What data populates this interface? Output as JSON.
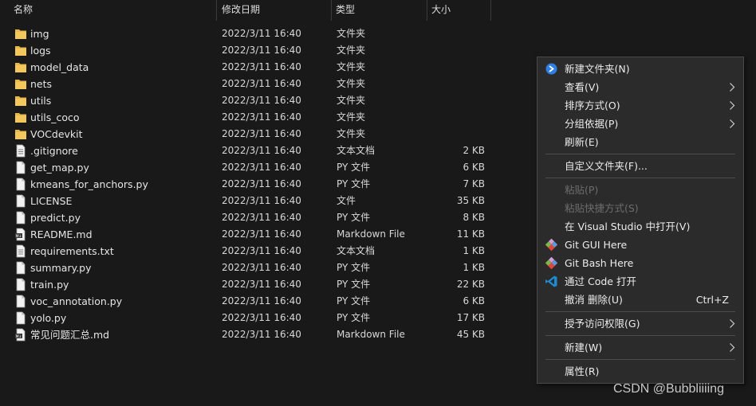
{
  "columns": {
    "name": "名称",
    "date": "修改日期",
    "type": "类型",
    "size": "大小"
  },
  "files": [
    {
      "name": "img",
      "date": "2022/3/11 16:40",
      "type": "文件夹",
      "size": "",
      "icon": "folder-icon"
    },
    {
      "name": "logs",
      "date": "2022/3/11 16:40",
      "type": "文件夹",
      "size": "",
      "icon": "folder-icon"
    },
    {
      "name": "model_data",
      "date": "2022/3/11 16:40",
      "type": "文件夹",
      "size": "",
      "icon": "folder-icon"
    },
    {
      "name": "nets",
      "date": "2022/3/11 16:40",
      "type": "文件夹",
      "size": "",
      "icon": "folder-icon"
    },
    {
      "name": "utils",
      "date": "2022/3/11 16:40",
      "type": "文件夹",
      "size": "",
      "icon": "folder-icon"
    },
    {
      "name": "utils_coco",
      "date": "2022/3/11 16:40",
      "type": "文件夹",
      "size": "",
      "icon": "folder-icon"
    },
    {
      "name": "VOCdevkit",
      "date": "2022/3/11 16:40",
      "type": "文件夹",
      "size": "",
      "icon": "folder-icon"
    },
    {
      "name": ".gitignore",
      "date": "2022/3/11 16:40",
      "type": "文本文档",
      "size": "2 KB",
      "icon": "text-file-icon"
    },
    {
      "name": "get_map.py",
      "date": "2022/3/11 16:40",
      "type": "PY 文件",
      "size": "6 KB",
      "icon": "file-icon"
    },
    {
      "name": "kmeans_for_anchors.py",
      "date": "2022/3/11 16:40",
      "type": "PY 文件",
      "size": "7 KB",
      "icon": "file-icon"
    },
    {
      "name": "LICENSE",
      "date": "2022/3/11 16:40",
      "type": "文件",
      "size": "35 KB",
      "icon": "file-icon"
    },
    {
      "name": "predict.py",
      "date": "2022/3/11 16:40",
      "type": "PY 文件",
      "size": "8 KB",
      "icon": "file-icon"
    },
    {
      "name": "README.md",
      "date": "2022/3/11 16:40",
      "type": "Markdown File",
      "size": "11 KB",
      "icon": "markdown-file-icon"
    },
    {
      "name": "requirements.txt",
      "date": "2022/3/11 16:40",
      "type": "文本文档",
      "size": "1 KB",
      "icon": "text-file-icon"
    },
    {
      "name": "summary.py",
      "date": "2022/3/11 16:40",
      "type": "PY 文件",
      "size": "1 KB",
      "icon": "file-icon"
    },
    {
      "name": "train.py",
      "date": "2022/3/11 16:40",
      "type": "PY 文件",
      "size": "22 KB",
      "icon": "file-icon"
    },
    {
      "name": "voc_annotation.py",
      "date": "2022/3/11 16:40",
      "type": "PY 文件",
      "size": "6 KB",
      "icon": "file-icon"
    },
    {
      "name": "yolo.py",
      "date": "2022/3/11 16:40",
      "type": "PY 文件",
      "size": "17 KB",
      "icon": "file-icon"
    },
    {
      "name": "常见问题汇总.md",
      "date": "2022/3/11 16:40",
      "type": "Markdown File",
      "size": "45 KB",
      "icon": "markdown-file-icon"
    }
  ],
  "context_menu": {
    "items": [
      {
        "label": "新建文件夹(N)",
        "icon": "new-folder-icon",
        "submenu": false,
        "disabled": false
      },
      {
        "label": "查看(V)",
        "submenu": true,
        "disabled": false
      },
      {
        "label": "排序方式(O)",
        "submenu": true,
        "disabled": false
      },
      {
        "label": "分组依据(P)",
        "submenu": true,
        "disabled": false
      },
      {
        "label": "刷新(E)",
        "submenu": false,
        "disabled": false
      },
      {
        "label": "自定义文件夹(F)...",
        "submenu": false,
        "disabled": false
      },
      {
        "label": "粘贴(P)",
        "submenu": false,
        "disabled": true
      },
      {
        "label": "粘贴快捷方式(S)",
        "submenu": false,
        "disabled": true
      },
      {
        "label": "在 Visual Studio 中打开(V)",
        "submenu": false,
        "disabled": false
      },
      {
        "label": "Git GUI Here",
        "icon": "git-gui-icon",
        "submenu": false,
        "disabled": false
      },
      {
        "label": "Git Bash Here",
        "icon": "git-bash-icon",
        "submenu": false,
        "disabled": false
      },
      {
        "label": "通过 Code 打开",
        "icon": "vscode-icon",
        "submenu": false,
        "disabled": false
      },
      {
        "label": "撤消 删除(U)",
        "shortcut": "Ctrl+Z",
        "submenu": false,
        "disabled": false
      },
      {
        "label": "授予访问权限(G)",
        "submenu": true,
        "disabled": false
      },
      {
        "label": "新建(W)",
        "submenu": true,
        "disabled": false
      },
      {
        "label": "属性(R)",
        "submenu": false,
        "disabled": false
      }
    ]
  },
  "watermark": "CSDN @Bubbliiiing",
  "colors": {
    "background": "#191919",
    "folder": "#e8b84b",
    "menu_background": "#2b2b2b",
    "disabled_text": "#6d6d6d",
    "accent_blue": "#2f7fe0"
  }
}
